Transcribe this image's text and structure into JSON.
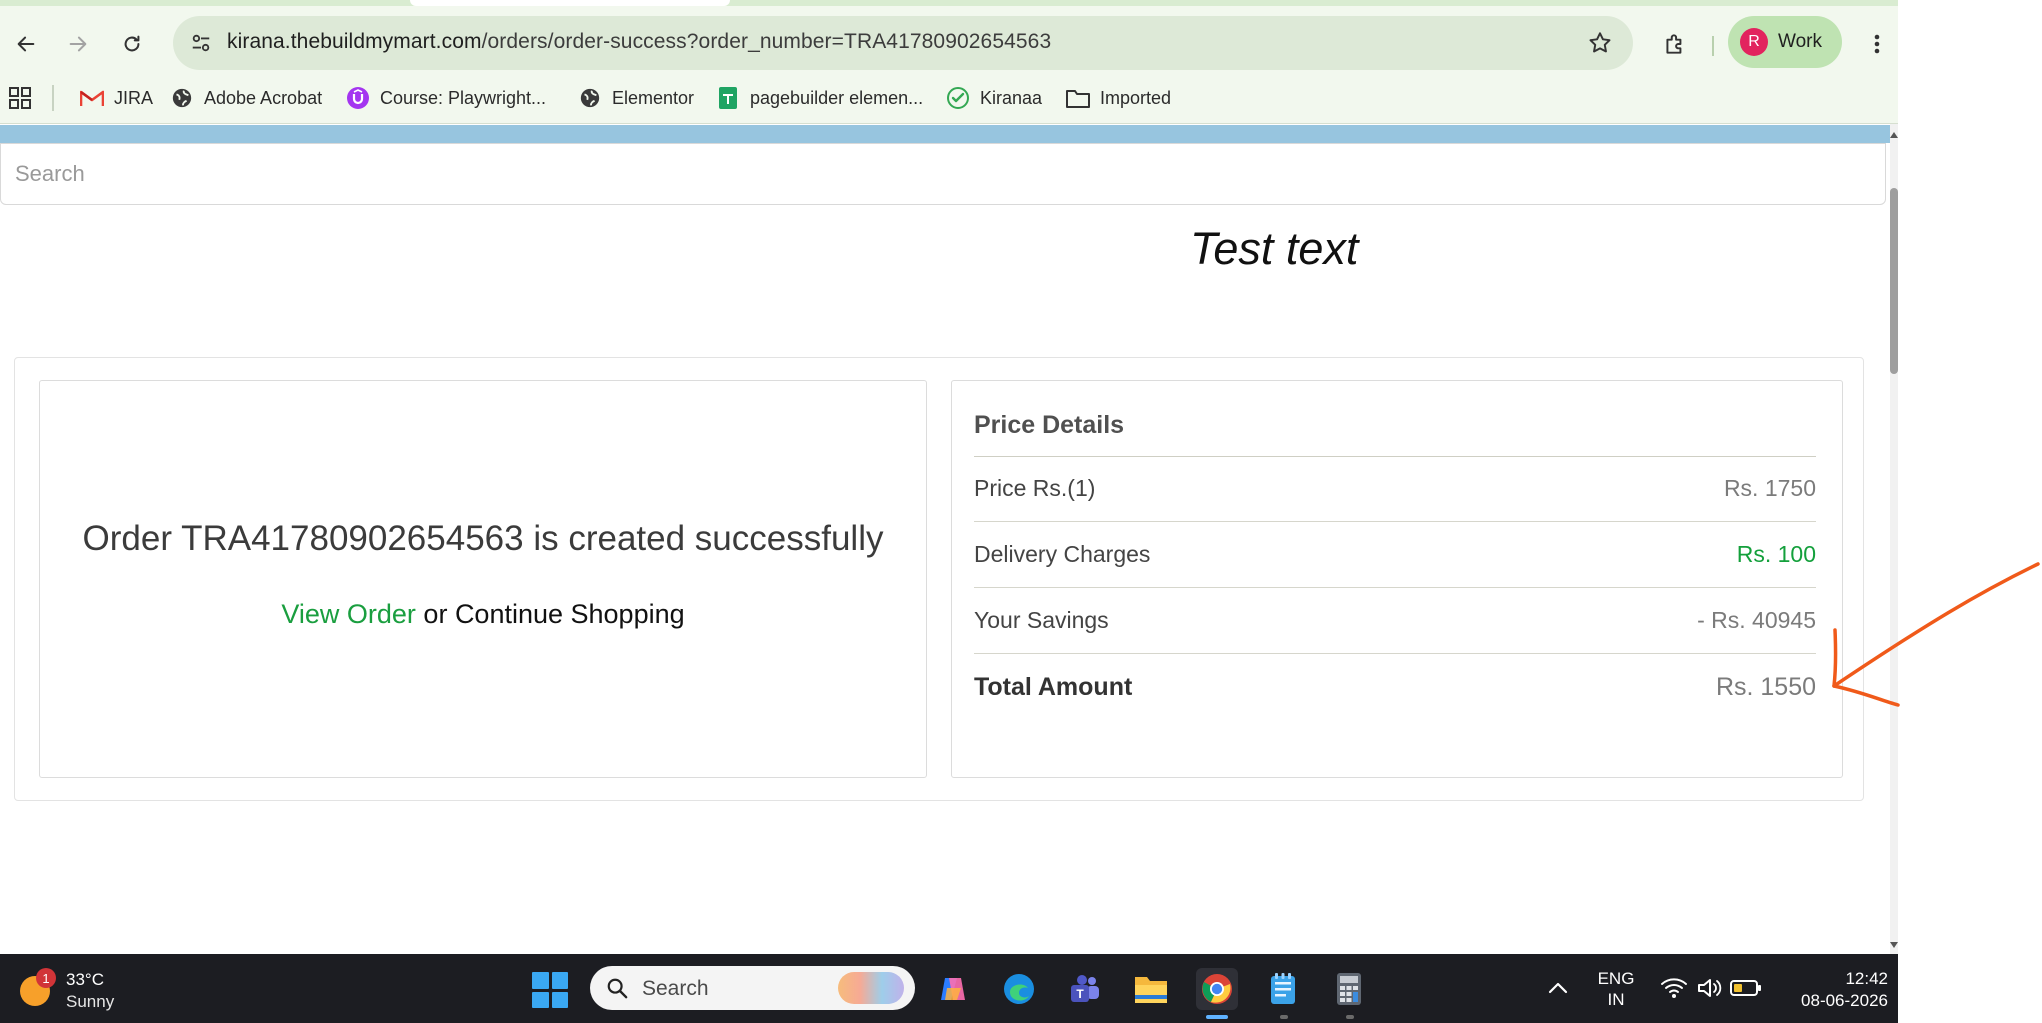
{
  "browser": {
    "url_domain": "kirana.thebuildmymart.com",
    "url_path": "/orders/order-success?order_number=TRA41780902654563",
    "profile_initial": "R",
    "profile_label": "Work",
    "bookmarks": [
      {
        "label": "JIRA",
        "icon": "gmail-icon"
      },
      {
        "label": "Adobe Acrobat",
        "icon": "globe-icon"
      },
      {
        "label": "Course: Playwright...",
        "icon": "udemy-icon"
      },
      {
        "label": "Elementor",
        "icon": "globe-icon"
      },
      {
        "label": "pagebuilder elemen...",
        "icon": "sheets-icon"
      },
      {
        "label": "Kiranaa",
        "icon": "check-circle-icon"
      },
      {
        "label": "Imported",
        "icon": "folder-icon"
      }
    ]
  },
  "page": {
    "search_placeholder": "Search",
    "test_text": "Test text",
    "order": {
      "message": "Order TRA41780902654563 is created successfully",
      "view_order_label": "View Order",
      "or_label": " or ",
      "continue_label": "Continue Shopping"
    },
    "price_details": {
      "title": "Price Details",
      "rows": [
        {
          "label": "Price Rs.(1)",
          "value": "Rs. 1750"
        },
        {
          "label": "Delivery Charges",
          "value": "Rs. 100"
        },
        {
          "label": "Your Savings",
          "value": "- Rs. 40945"
        },
        {
          "label": "Total Amount",
          "value": "Rs. 1550"
        }
      ]
    }
  },
  "taskbar": {
    "weather_badge": "1",
    "temperature": "33°C",
    "condition": "Sunny",
    "search_label": "Search",
    "lang_primary": "ENG",
    "lang_secondary": "IN",
    "time": "12:42",
    "date": "08-06-2026"
  },
  "colors": {
    "accent_green": "#14a03c",
    "annotation": "#f05a1a",
    "page_bluebar": "#97c5df"
  }
}
